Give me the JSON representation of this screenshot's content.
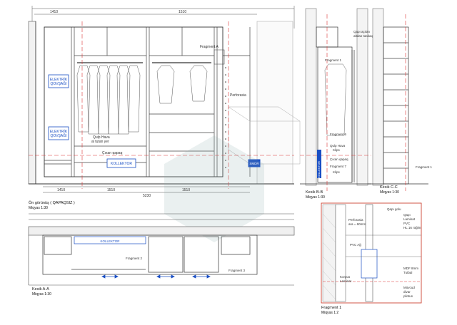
{
  "front_view": {
    "label_elektrik_1": "ELEKTRİK",
    "label_elektrik_1b": "QOVŞAĞI",
    "label_elektrik_2": "ELEKTRİK",
    "label_elektrik_2b": "QOVŞAĞI",
    "label_kollektor": "KOLLEKTOR",
    "label_qulp_1": "Qulp Hava",
    "label_qulp_2": "al tutan yer",
    "label_cixan": "Çıxan qapaq",
    "label_fragment_a": "Fragment A",
    "label_perforasia": "Perforasia",
    "label_smdr": "SMDR",
    "dim_top_left": "1410",
    "dim_top_mid": "1510",
    "dim_bottom_1": "1410",
    "dim_bottom_2": "1510",
    "dim_bottom_3": "1510",
    "dim_total": "5230",
    "label_title": "Ön görünüş ( QAPAQSIZ )",
    "label_scale": "Miqyas 1:30"
  },
  "section_b": {
    "label_fragment_1": "Fragment 1",
    "label_qapi": "Qapı açılan",
    "label_qapi_2": "altdan tutulaq",
    "label_fragment_6": "Fragment 6",
    "label_qulp_2": "Qulp Hava",
    "label_klips": "Klips",
    "label_cixan_2": "Çıxan qapaq",
    "label_fragment_7": "Fragment 7",
    "label_klips_2": "Klips",
    "label_kollektor_v": "KOLLEKTOR",
    "label_title": "Kesik B-B",
    "label_scale": "Miqyas 1:30"
  },
  "section_c": {
    "label_fragment_1": "Fragment 1",
    "label_title": "Kesik C-C",
    "label_scale": "Miqyas 1:30"
  },
  "section_a": {
    "label_kollektor": "KOLLEKTOR",
    "label_fragment_2": "Fragment 2",
    "label_fragment_3": "Fragment 3",
    "label_title": "Kesik A-A",
    "label_scale": "Miqyas 1:30"
  },
  "fragment_detail": {
    "label_perforasia": "Perforasia",
    "label_perforasia_2": "ara = 60mm",
    "label_qapi_gol": "Qapı golu",
    "label_qapi_laminat": "Qapı",
    "label_qapi_laminat_2": "Laminat",
    "label_pvc": "PVC",
    "label_hl": "HL 16 rəğlm",
    "label_pvc_ag": "PVC Ağ",
    "label_mdf": "MDF 8mm",
    "label_tutbal": "Tutbal",
    "label_korpus": "Korpus",
    "label_laminat": "Laminat",
    "label_movcud": "Mövcud",
    "label_divar": "divar",
    "label_plintus": "plintus",
    "label_title": "Fragment 1",
    "label_scale": "Miqyas 1:2"
  }
}
